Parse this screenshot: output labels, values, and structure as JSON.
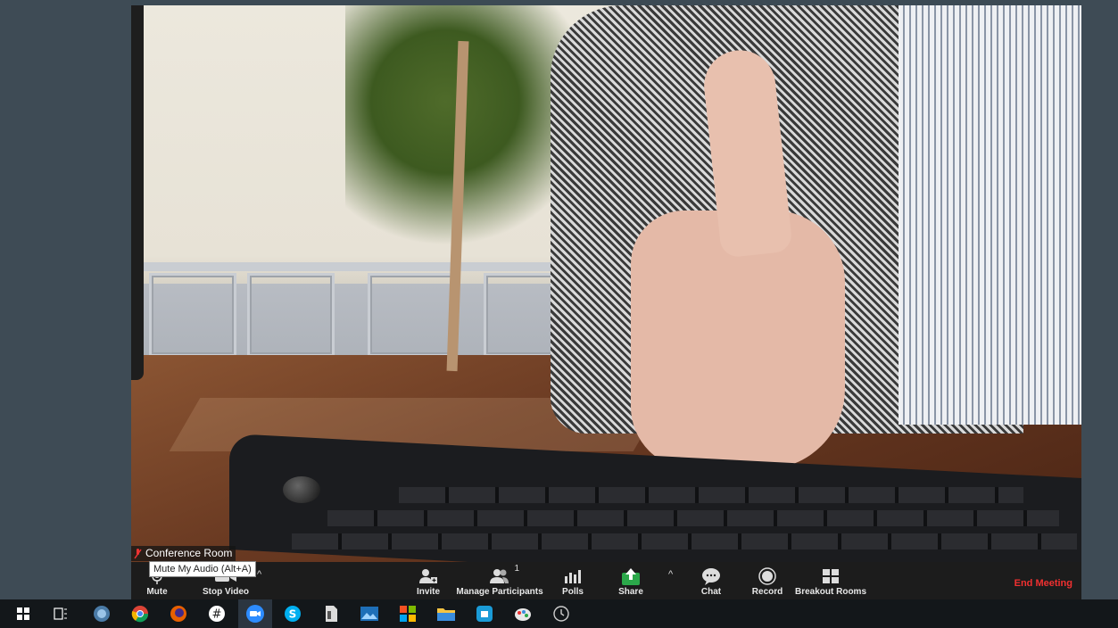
{
  "video": {
    "participant_name": "Conference Room"
  },
  "tooltip": "Mute My Audio (Alt+A)",
  "toolbar": {
    "mute_label": "Mute",
    "stop_video_label": "Stop Video",
    "invite_label": "Invite",
    "manage_participants_label": "Manage Participants",
    "participant_count": "1",
    "polls_label": "Polls",
    "share_label": "Share",
    "chat_label": "Chat",
    "record_label": "Record",
    "breakout_rooms_label": "Breakout Rooms",
    "end_meeting_label": "End Meeting",
    "share_color": "#2ba84a",
    "end_color": "#f03030"
  },
  "taskbar": {
    "icons": [
      "windows-start-icon",
      "task-view-icon",
      "settings-globe-icon",
      "chrome-icon",
      "firefox-icon",
      "slack-icon",
      "zoom-icon",
      "skype-icon",
      "file-icon",
      "photos-icon",
      "store-icon",
      "file-explorer-icon",
      "box-icon",
      "paint-icon",
      "clock-icon"
    ]
  }
}
